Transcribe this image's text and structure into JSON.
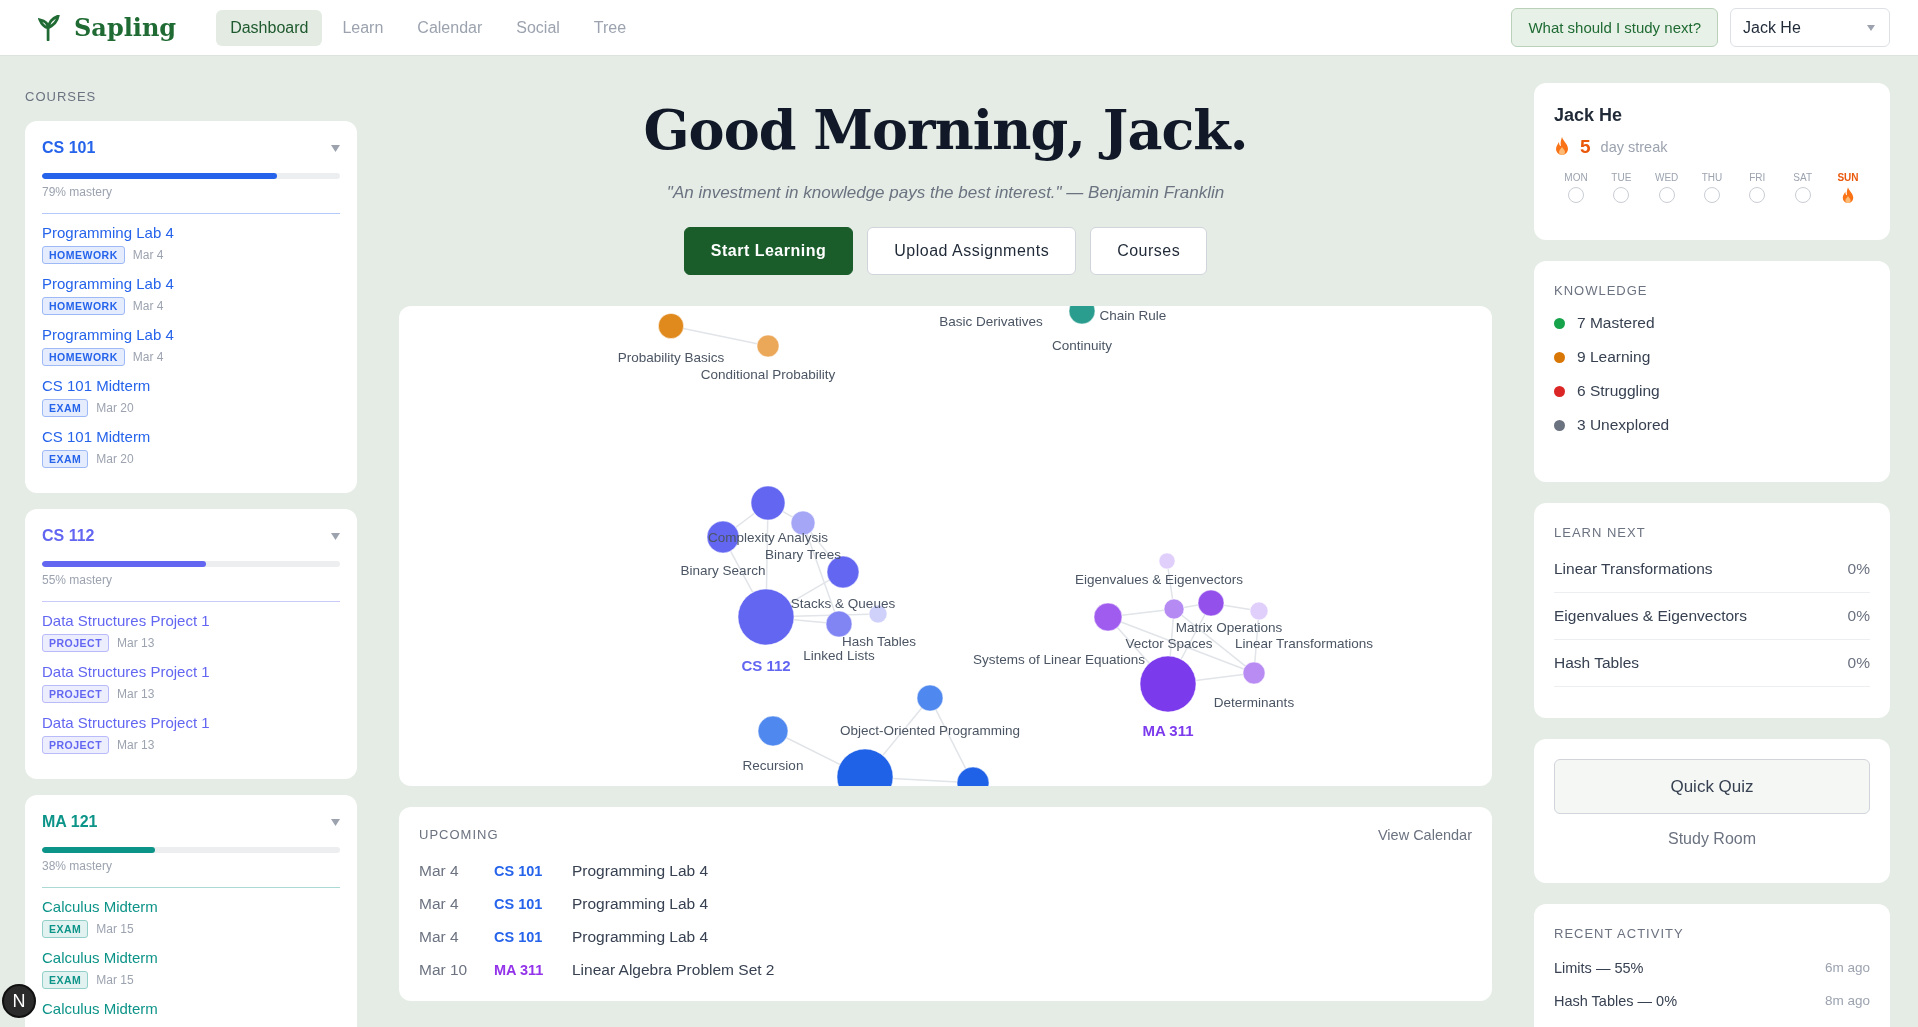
{
  "app": {
    "logo": "Sapling",
    "nav": [
      {
        "label": "Dashboard",
        "selected": true
      },
      {
        "label": "Learn",
        "selected": false
      },
      {
        "label": "Calendar",
        "selected": false
      },
      {
        "label": "Social",
        "selected": false
      },
      {
        "label": "Tree",
        "selected": false
      }
    ],
    "ask_button": "What should I study next?",
    "user_select": "Jack He"
  },
  "courses": {
    "heading": "COURSES",
    "cards": [
      {
        "name": "CS 101",
        "color": "#2563eb",
        "level": 0.79,
        "mastery": "79% mastery",
        "expanded": true,
        "items": [
          {
            "title": "Programming Lab 4",
            "tag": "HOMEWORK",
            "date": "Mar 4"
          },
          {
            "title": "Programming Lab 4",
            "tag": "HOMEWORK",
            "date": "Mar 4"
          },
          {
            "title": "Programming Lab 4",
            "tag": "HOMEWORK",
            "date": "Mar 4"
          },
          {
            "title": "CS 101 Midterm",
            "tag": "EXAM",
            "date": "Mar 20"
          },
          {
            "title": "CS 101 Midterm",
            "tag": "EXAM",
            "date": "Mar 20"
          }
        ]
      },
      {
        "name": "CS 112",
        "color": "#6366f1",
        "level": 0.55,
        "mastery": "55% mastery",
        "expanded": true,
        "items": [
          {
            "title": "Data Structures Project 1",
            "tag": "PROJECT",
            "date": "Mar 13"
          },
          {
            "title": "Data Structures Project 1",
            "tag": "PROJECT",
            "date": "Mar 13"
          },
          {
            "title": "Data Structures Project 1",
            "tag": "PROJECT",
            "date": "Mar 13"
          }
        ]
      },
      {
        "name": "MA 121",
        "color": "#0d9488",
        "level": 0.38,
        "mastery": "38% mastery",
        "expanded": true,
        "items": [
          {
            "title": "Calculus Midterm",
            "tag": "EXAM",
            "date": "Mar 15"
          },
          {
            "title": "Calculus Midterm",
            "tag": "EXAM",
            "date": "Mar 15"
          },
          {
            "title": "Calculus Midterm"
          }
        ]
      }
    ]
  },
  "hero": {
    "greeting": "Good Morning, Jack.",
    "quote": "\"An investment in knowledge pays the best interest.\" — Benjamin Franklin",
    "buttons": [
      {
        "label": "Start Learning",
        "kind": "primary"
      },
      {
        "label": "Upload Assignments",
        "kind": "secondary"
      },
      {
        "label": "Courses",
        "kind": "secondary"
      }
    ]
  },
  "graph": {
    "nodes": [
      {
        "color": "#e08a1e"
      },
      {
        "color": "#eba859"
      },
      {
        "color": "#2a9d8f"
      },
      {
        "color": "#6366f1"
      },
      {
        "color": "#a5a7f6"
      },
      {
        "color": "#6366f1"
      },
      {
        "color": "#6366f1"
      },
      {
        "color": "#6366f1"
      },
      {
        "color": "#8185f3"
      },
      {
        "color": "#d0d1fb"
      },
      {
        "color": "#7c3aed"
      },
      {
        "color": "#a05cef"
      },
      {
        "color": "#b58af2"
      },
      {
        "color": "#9350ea"
      },
      {
        "color": "#e0cffb"
      },
      {
        "color": "#e0cffb"
      },
      {
        "color": "#b88cf3"
      },
      {
        "color": "#4f88ee"
      },
      {
        "color": "#4f88ee"
      },
      {
        "color": "#1f62e7"
      },
      {
        "color": "#1f62e7"
      }
    ],
    "labels": [
      {
        "text": "Probability Basics",
        "kind": "topic"
      },
      {
        "text": "Conditional Probability",
        "kind": "topic"
      },
      {
        "text": "Basic Derivatives",
        "kind": "topic"
      },
      {
        "text": "Chain Rule",
        "kind": "topic"
      },
      {
        "text": "Continuity",
        "kind": "topic"
      },
      {
        "text": "Complexity Analysis",
        "kind": "topic"
      },
      {
        "text": "Binary Trees",
        "kind": "topic"
      },
      {
        "text": "Binary Search",
        "kind": "topic"
      },
      {
        "text": "Stacks & Queues",
        "kind": "topic"
      },
      {
        "text": "Hash Tables",
        "kind": "topic"
      },
      {
        "text": "Linked Lists",
        "kind": "topic"
      },
      {
        "text": "CS 112",
        "kind": "course",
        "color": "#6366f1"
      },
      {
        "text": "Eigenvalues & Eigenvectors",
        "kind": "topic"
      },
      {
        "text": "Matrix Operations",
        "kind": "topic"
      },
      {
        "text": "Vector Spaces",
        "kind": "topic"
      },
      {
        "text": "Linear Transformations",
        "kind": "topic"
      },
      {
        "text": "Systems of Linear Equations",
        "kind": "topic"
      },
      {
        "text": "Determinants",
        "kind": "topic"
      },
      {
        "text": "MA 311",
        "kind": "course",
        "color": "#7c3aed"
      },
      {
        "text": "Object-Oriented Programming",
        "kind": "topic"
      },
      {
        "text": "Recursion",
        "kind": "topic"
      }
    ]
  },
  "upcoming": {
    "heading": "UPCOMING",
    "link": "View Calendar",
    "rows": [
      {
        "date": "Mar 4",
        "course": "CS 101",
        "color": "#2563eb",
        "title": "Programming Lab 4"
      },
      {
        "date": "Mar 4",
        "course": "CS 101",
        "color": "#2563eb",
        "title": "Programming Lab 4"
      },
      {
        "date": "Mar 4",
        "course": "CS 101",
        "color": "#2563eb",
        "title": "Programming Lab 4"
      },
      {
        "date": "Mar 10",
        "course": "MA 311",
        "color": "#9333ea",
        "title": "Linear Algebra Problem Set 2"
      }
    ]
  },
  "profile": {
    "name": "Jack He",
    "streak": "5",
    "streak_label": "day streak",
    "days": [
      {
        "label": "MON",
        "today": false
      },
      {
        "label": "TUE",
        "today": false
      },
      {
        "label": "WED",
        "today": false
      },
      {
        "label": "THU",
        "today": false
      },
      {
        "label": "FRI",
        "today": false
      },
      {
        "label": "SAT",
        "today": false
      },
      {
        "label": "SUN",
        "today": true
      }
    ]
  },
  "knowledge": {
    "heading": "KNOWLEDGE",
    "items": [
      {
        "label": "7 Mastered",
        "color": "#16a34a"
      },
      {
        "label": "9 Learning",
        "color": "#d97706"
      },
      {
        "label": "6 Struggling",
        "color": "#dc2626"
      },
      {
        "label": "3 Unexplored",
        "color": "#6b7280"
      }
    ]
  },
  "learn_next": {
    "heading": "LEARN NEXT",
    "rows": [
      {
        "topic": "Linear Transformations",
        "value": "0%"
      },
      {
        "topic": "Eigenvalues & Eigenvectors",
        "value": "0%"
      },
      {
        "topic": "Hash Tables",
        "value": "0%"
      }
    ]
  },
  "actions": {
    "quiz": "Quick Quiz",
    "room": "Study Room"
  },
  "recent": {
    "heading": "RECENT ACTIVITY",
    "rows": [
      {
        "text": "Limits — 55%",
        "time": "6m ago"
      },
      {
        "text": "Hash Tables — 0%",
        "time": "8m ago"
      }
    ]
  },
  "dev_badge": "N"
}
